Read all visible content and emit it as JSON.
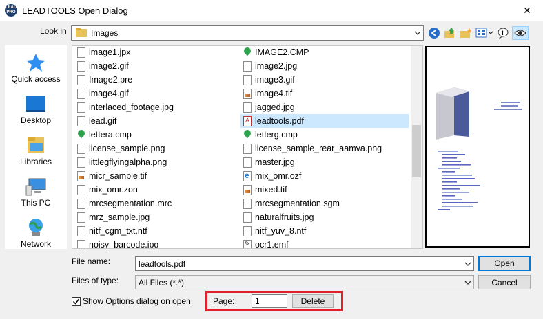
{
  "window": {
    "title": "LEADTOOLS Open Dialog",
    "app_icon_text": "LEAD PRO",
    "close_glyph": "✕"
  },
  "lookin": {
    "label": "Look in",
    "value": "Images"
  },
  "places": [
    {
      "label": "Quick access",
      "icon": "star-icon"
    },
    {
      "label": "Desktop",
      "icon": "desktop-icon"
    },
    {
      "label": "Libraries",
      "icon": "libraries-icon"
    },
    {
      "label": "This PC",
      "icon": "computer-icon"
    },
    {
      "label": "Network",
      "icon": "network-icon"
    }
  ],
  "files_col1": [
    {
      "name": "image1.jpx",
      "icon": "file"
    },
    {
      "name": "image2.gif",
      "icon": "file"
    },
    {
      "name": "Image2.pre",
      "icon": "file"
    },
    {
      "name": "image4.gif",
      "icon": "file"
    },
    {
      "name": "interlaced_footage.jpg",
      "icon": "file"
    },
    {
      "name": "lead.gif",
      "icon": "file"
    },
    {
      "name": "lettera.cmp",
      "icon": "pin"
    },
    {
      "name": "license_sample.png",
      "icon": "file"
    },
    {
      "name": "littlegflyingalpha.png",
      "icon": "file"
    },
    {
      "name": "micr_sample.tif",
      "icon": "img"
    },
    {
      "name": "mix_omr.zon",
      "icon": "file"
    },
    {
      "name": "mrcsegmentation.mrc",
      "icon": "file"
    },
    {
      "name": "mrz_sample.jpg",
      "icon": "file"
    },
    {
      "name": "nitf_cgm_txt.ntf",
      "icon": "file"
    },
    {
      "name": "noisy_barcode.jpg",
      "icon": "file"
    }
  ],
  "files_col2": [
    {
      "name": "IMAGE2.CMP",
      "icon": "pin"
    },
    {
      "name": "image2.jpg",
      "icon": "file"
    },
    {
      "name": "image3.gif",
      "icon": "file"
    },
    {
      "name": "image4.tif",
      "icon": "img"
    },
    {
      "name": "jagged.jpg",
      "icon": "file"
    },
    {
      "name": "leadtools.pdf",
      "icon": "pdf",
      "selected": true
    },
    {
      "name": "letterg.cmp",
      "icon": "pin"
    },
    {
      "name": "license_sample_rear_aamva.png",
      "icon": "file"
    },
    {
      "name": "master.jpg",
      "icon": "file"
    },
    {
      "name": "mix_omr.ozf",
      "icon": "web"
    },
    {
      "name": "mixed.tif",
      "icon": "img"
    },
    {
      "name": "mrcsegmentation.sgm",
      "icon": "file"
    },
    {
      "name": "naturalfruits.jpg",
      "icon": "file"
    },
    {
      "name": "nitf_yuv_8.ntf",
      "icon": "file"
    },
    {
      "name": "ocr1.emf",
      "icon": "emf"
    }
  ],
  "filename": {
    "label": "File name:",
    "value": "leadtools.pdf"
  },
  "filetype": {
    "label": "Files of type:",
    "value": "All Files (*.*)"
  },
  "buttons": {
    "open": "Open",
    "cancel": "Cancel",
    "delete": "Delete"
  },
  "options": {
    "show_options_label": "Show Options dialog on open",
    "checked": true
  },
  "page": {
    "label": "Page:",
    "value": "1"
  },
  "colors": {
    "selection": "#cce8ff",
    "highlight_box": "#e0202a",
    "default_button_border": "#0078d7"
  }
}
